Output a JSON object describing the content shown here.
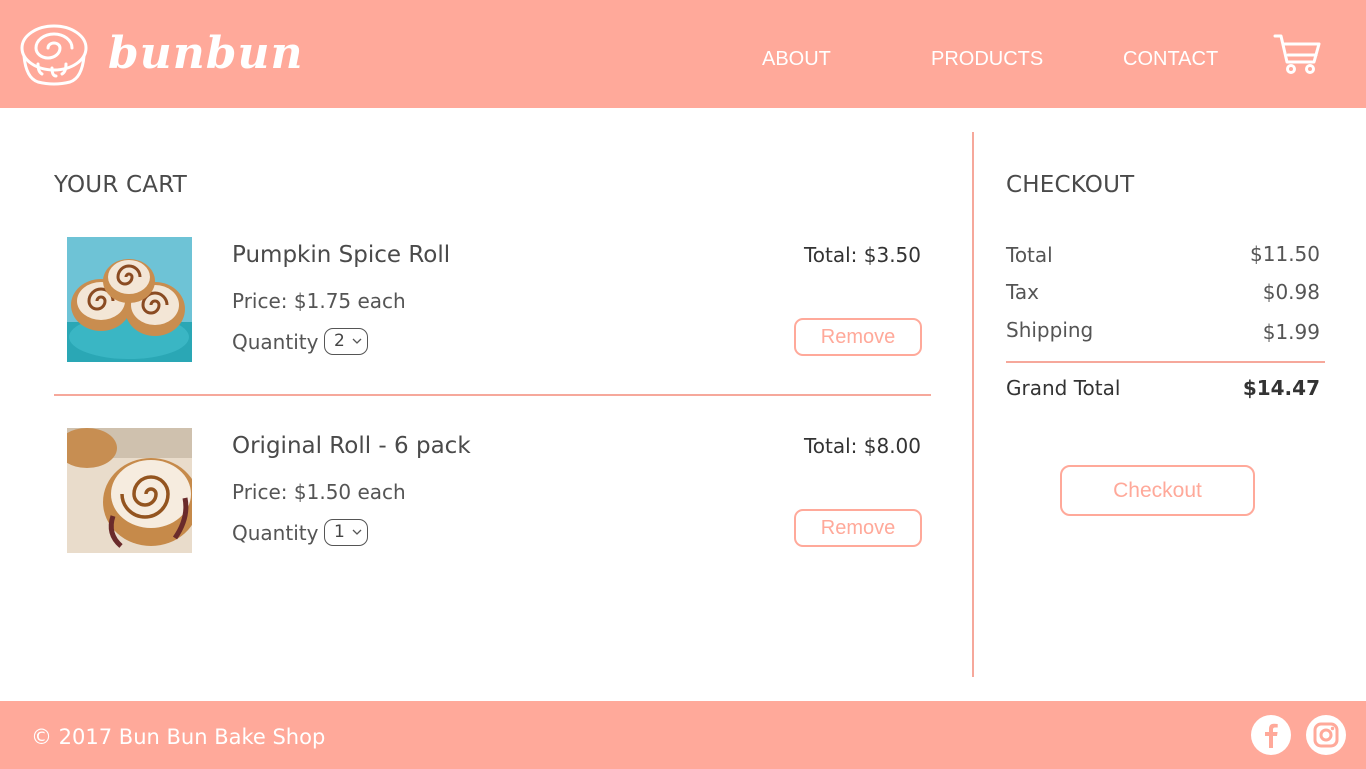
{
  "header": {
    "brand": "bunbun",
    "nav": {
      "about": "ABOUT",
      "products": "PRODUCTS",
      "contact": "CONTACT"
    }
  },
  "cart": {
    "title": "YOUR CART",
    "items": [
      {
        "name": "Pumpkin Spice Roll",
        "price": "Price: $1.75 each",
        "quantity_label": "Quantity",
        "quantity": "2",
        "total": "Total: $3.50",
        "remove_label": "Remove"
      },
      {
        "name": "Original Roll - 6 pack",
        "price": "Price: $1.50 each",
        "quantity_label": "Quantity",
        "quantity": "1",
        "total": "Total: $8.00",
        "remove_label": "Remove"
      }
    ]
  },
  "checkout": {
    "title": "CHECKOUT",
    "rows": [
      {
        "label": "Total",
        "value": "$11.50"
      },
      {
        "label": "Tax",
        "value": "$0.98"
      },
      {
        "label": "Shipping",
        "value": "$1.99"
      }
    ],
    "grand_total_label": "Grand Total",
    "grand_total_value": "$14.47",
    "button_label": "Checkout"
  },
  "footer": {
    "copyright": "© 2017 Bun Bun Bake Shop"
  },
  "colors": {
    "accent": "#ffa99a",
    "text": "#4a4a4a"
  },
  "icons": {
    "logo": "cinnamon-roll-icon",
    "cart": "shopping-cart-icon",
    "facebook": "facebook-icon",
    "instagram": "instagram-icon"
  }
}
